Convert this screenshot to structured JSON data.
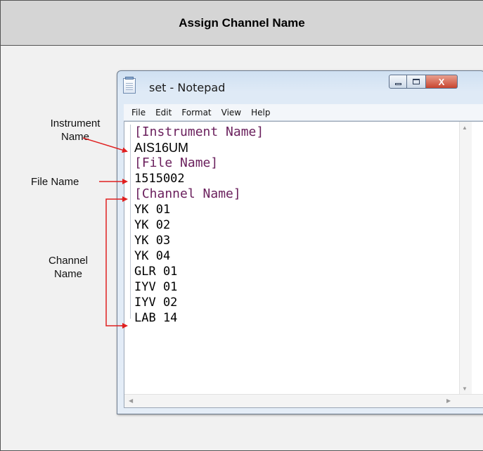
{
  "figure": {
    "header_title": "Assign Channel Name"
  },
  "notepad": {
    "title": "set - Notepad",
    "app_icon": "notepad-icon",
    "controls": {
      "minimize_icon": "minimize-icon",
      "maximize_icon": "maximize-icon",
      "close_icon": "close-icon",
      "close_glyph": "X"
    },
    "menu": [
      "File",
      "Edit",
      "Format",
      "View",
      "Help"
    ],
    "lines": [
      "[Instrument Name]",
      "AIS16UM",
      "[File Name]",
      "1515002",
      "[Channel Name]",
      "YK 01",
      "YK 02",
      "YK 03",
      "YK 04",
      "GLR 01",
      "IYV 01",
      "IYV 02",
      "LAB 14"
    ]
  },
  "annotations": {
    "instrument_name": {
      "line1": "Instrument",
      "line2": "Name"
    },
    "file_name": "File Name",
    "channel_name": {
      "line1": "Channel",
      "line2": "Name"
    }
  },
  "colors": {
    "arrow": "#e02020",
    "section_text": "#6a1f5c"
  }
}
